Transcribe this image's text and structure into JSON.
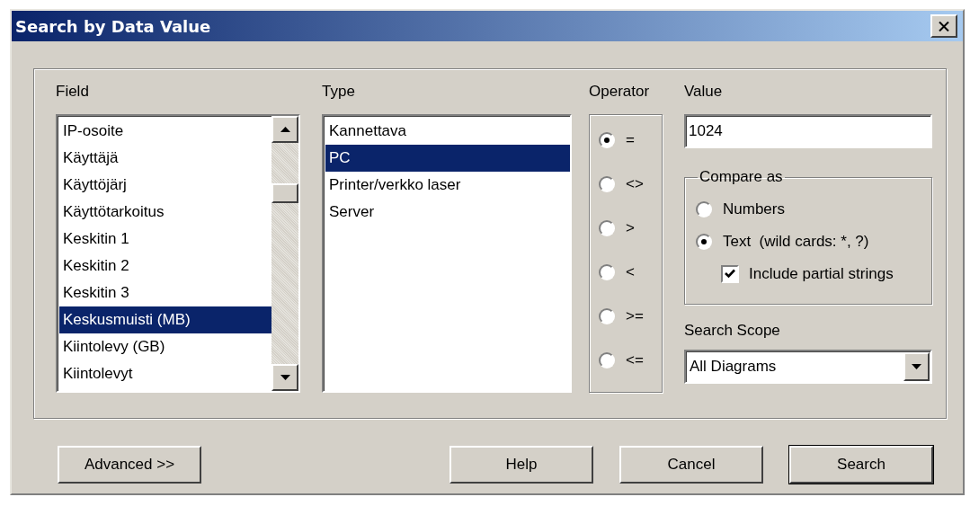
{
  "window": {
    "title": "Search by Data Value"
  },
  "field": {
    "label": "Field",
    "items": [
      {
        "text": "IP-osoite",
        "selected": false
      },
      {
        "text": "Käyttäjä",
        "selected": false
      },
      {
        "text": "Käyttöjärj",
        "selected": false
      },
      {
        "text": "Käyttötarkoitus",
        "selected": false
      },
      {
        "text": "Keskitin 1",
        "selected": false
      },
      {
        "text": "Keskitin 2",
        "selected": false
      },
      {
        "text": "Keskitin 3",
        "selected": false
      },
      {
        "text": "Keskusmuisti (MB)",
        "selected": true
      },
      {
        "text": "Kiintolevy (GB)",
        "selected": false
      },
      {
        "text": "Kiintolevyt",
        "selected": false
      }
    ]
  },
  "type": {
    "label": "Type",
    "items": [
      {
        "text": "Kannettava",
        "selected": false
      },
      {
        "text": "PC",
        "selected": true
      },
      {
        "text": "Printer/verkko laser",
        "selected": false
      },
      {
        "text": "Server",
        "selected": false
      }
    ]
  },
  "operator": {
    "label": "Operator",
    "options": [
      {
        "text": "=",
        "selected": true
      },
      {
        "text": "<>",
        "selected": false
      },
      {
        "text": ">",
        "selected": false
      },
      {
        "text": "<",
        "selected": false
      },
      {
        "text": ">=",
        "selected": false
      },
      {
        "text": "<=",
        "selected": false
      }
    ]
  },
  "value": {
    "label": "Value",
    "value": "1024"
  },
  "compare_as": {
    "label": "Compare as",
    "options": [
      {
        "text": "Numbers",
        "selected": false
      },
      {
        "text": "Text  (wild cards: *, ?)",
        "selected": true
      }
    ],
    "include_partial": {
      "label": "Include partial strings",
      "checked": true
    }
  },
  "search_scope": {
    "label": "Search Scope",
    "value": "All Diagrams"
  },
  "buttons": [
    {
      "label": "Advanced >>",
      "default": false
    },
    {
      "label": "Help",
      "default": false
    },
    {
      "label": "Cancel",
      "default": false
    },
    {
      "label": "Search",
      "default": true
    }
  ]
}
